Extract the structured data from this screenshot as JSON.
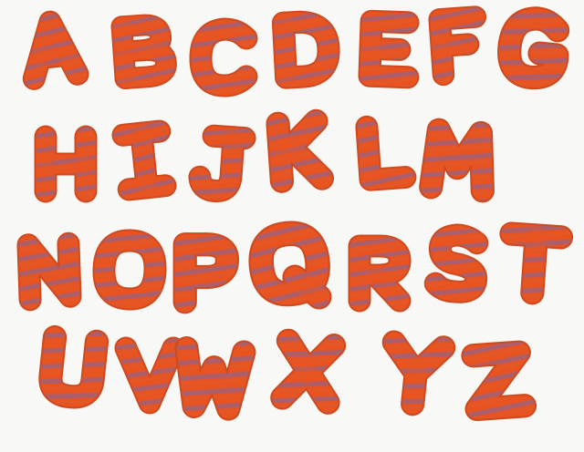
{
  "letters": [
    "A",
    "B",
    "C",
    "D",
    "E",
    "F",
    "G",
    "H",
    "I",
    "J",
    "K",
    "L",
    "M",
    "N",
    "O",
    "P",
    "Q",
    "R",
    "S",
    "T",
    "U",
    "V",
    "W",
    "X",
    "Y",
    "Z"
  ],
  "colors": {
    "background": "#f8f8f6",
    "letter_orange": "#e8531f",
    "letter_orange_dark": "#cf4a1e",
    "stripe_purple": "#7b6aa8"
  }
}
